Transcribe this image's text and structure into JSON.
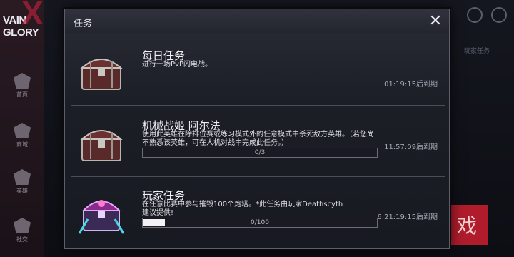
{
  "background": {
    "logo": {
      "line1": "VAIN",
      "line2": "GLORY"
    },
    "rail": [
      {
        "label": "首页"
      },
      {
        "label": "商城"
      },
      {
        "label": "英雄"
      },
      {
        "label": "社交"
      }
    ],
    "side_note": "玩家任务",
    "play_button": "戏"
  },
  "modal": {
    "title": "任务",
    "close_icon": "close-icon",
    "quests": [
      {
        "title": "每日任务",
        "description": "进行一场PvP闪电战。",
        "time": "01:19:15后到期",
        "chest": "daily-chest-icon"
      },
      {
        "title": "机械战姬 阿尔法",
        "description": "使用此英雄在除排位赛或练习模式外的任意模式中杀死敌方英雄。（若您尚不熟悉该英雄，可在人机对战中完成此任务。）",
        "time": "11:57:09后到期",
        "progress_text": "0/3",
        "progress": 0,
        "chest": "hero-chest-icon"
      },
      {
        "title": "玩家任务",
        "description": "在任意比赛中参与摧毁100个炮塔。*此任务由玩家Deathscyth建议提供!",
        "time": "6:21:19:15后到期",
        "progress_text": "0/100",
        "progress": 0.09,
        "chest": "player-chest-icon"
      }
    ]
  },
  "colors": {
    "accent": "#b01c2c",
    "panel": "#1c1e26",
    "border": "#5b5f6b"
  }
}
